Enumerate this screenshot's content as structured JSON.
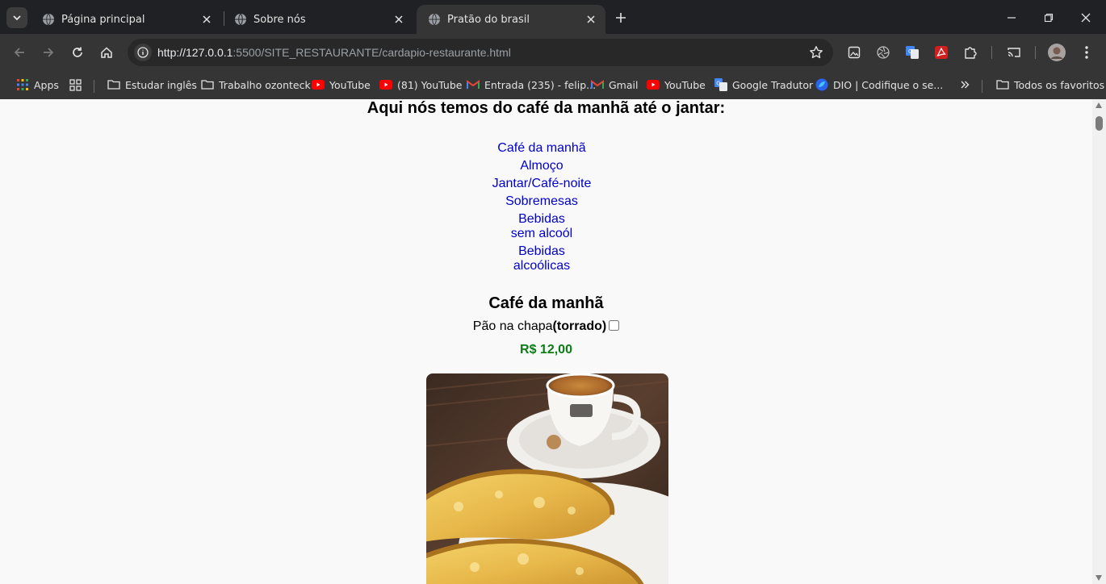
{
  "browser": {
    "tabs": [
      {
        "title": "Página principal",
        "active": false
      },
      {
        "title": "Sobre nós",
        "active": false
      },
      {
        "title": "Pratão do brasil",
        "active": true
      }
    ],
    "url_host": "http://127.0.0.1",
    "url_rest": ":5500/SITE_RESTAURANTE/cardapio-restaurante.html",
    "bookmarks": [
      {
        "label": "Apps",
        "icon": "apps-grid-icon"
      },
      {
        "label": "Estudar inglês",
        "icon": "folder-icon"
      },
      {
        "label": "Trabalho ozonteck",
        "icon": "folder-icon"
      },
      {
        "label": "YouTube",
        "icon": "youtube-icon"
      },
      {
        "label": "(81) YouTube",
        "icon": "youtube-icon"
      },
      {
        "label": "Entrada (235) - felip...",
        "icon": "gmail-icon"
      },
      {
        "label": "Gmail",
        "icon": "gmail-icon"
      },
      {
        "label": "YouTube",
        "icon": "youtube-icon"
      },
      {
        "label": "Google Tradutor",
        "icon": "google-translate-icon"
      },
      {
        "label": "DIO | Codifique o se...",
        "icon": "dio-icon"
      }
    ],
    "all_bookmarks_label": "Todos os favoritos"
  },
  "page": {
    "heading": "Aqui nós temos do café da manhã até o jantar:",
    "menu": [
      "Café da manhã",
      "Almoço",
      "Jantar/Café-noite",
      "Sobremesas",
      "Bebidas sem alcoól",
      "Bebidas alcoólicas"
    ],
    "section_title": "Café da manhã",
    "item_name": "Pão na chapa",
    "item_detail": "(torrado)",
    "item_price": "R$ 12,00",
    "colors": {
      "link": "#0000cc",
      "price": "#0a7d16"
    }
  }
}
